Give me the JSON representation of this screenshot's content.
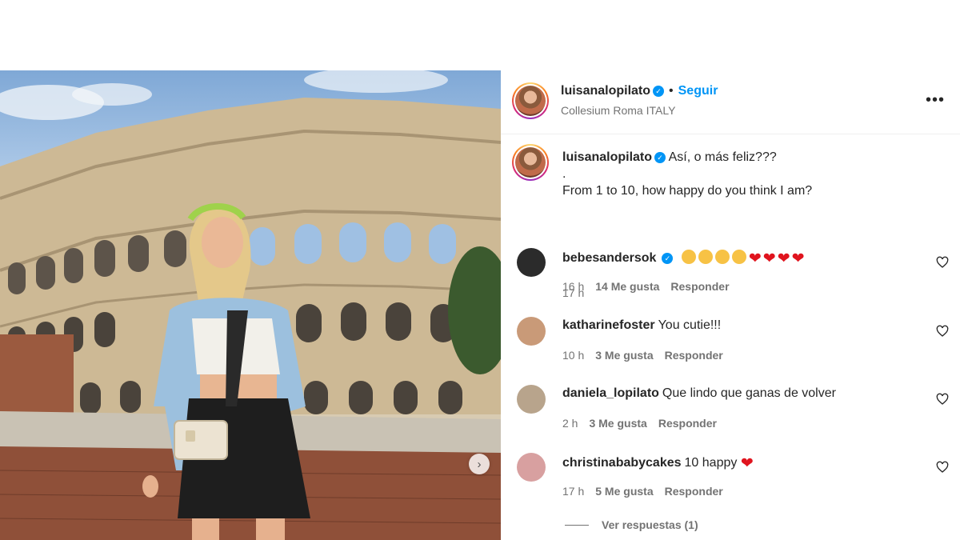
{
  "post": {
    "username": "luisanalopilato",
    "verified": true,
    "separator": "•",
    "follow_label": "Seguir",
    "location": "Collesium Roma ITALY",
    "more_icon": "more-options-icon",
    "caption_lines": [
      "Así, o más feliz??? ",
      ".",
      "From 1 to 10, how happy do you think I am? "
    ],
    "caption_time": "17 h"
  },
  "comments": [
    {
      "username": "bebesandersok",
      "verified": true,
      "text": "",
      "emoji": [
        "clap",
        "clap",
        "clap",
        "clap",
        "heart",
        "heart",
        "heart",
        "heart"
      ],
      "time": "16 h",
      "likes": "14 Me gusta",
      "reply": "Responder",
      "avatar_color": "#2b2b2b"
    },
    {
      "username": "katharinefoster",
      "verified": false,
      "text": "You cutie!!!",
      "emoji": [],
      "time": "10 h",
      "likes": "3 Me gusta",
      "reply": "Responder",
      "avatar_color": "#c99a78"
    },
    {
      "username": "daniela_lopilato",
      "verified": false,
      "text": "Que lindo que ganas de volver",
      "emoji": [],
      "time": "2 h",
      "likes": "3 Me gusta",
      "reply": "Responder",
      "avatar_color": "#b8a48c"
    },
    {
      "username": "christinababycakes",
      "verified": false,
      "text": "10 happy",
      "emoji": [
        "heart"
      ],
      "time": "17 h",
      "likes": "5 Me gusta",
      "reply": "Responder",
      "avatar_color": "#d8a0a0"
    }
  ],
  "view_replies": "Ver respuestas (1)",
  "colors": {
    "accent": "#0095f6",
    "muted": "#737373",
    "text": "#262626",
    "heart": "#e0141e"
  }
}
